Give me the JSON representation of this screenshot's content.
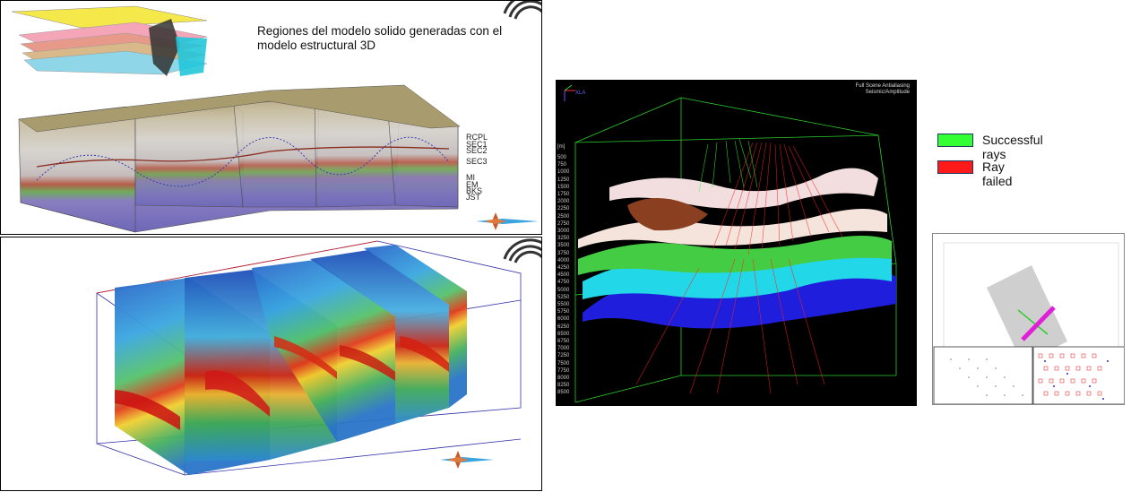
{
  "panel_structural": {
    "title": "Regiones del modelo solido generadas con el modelo estructural 3D",
    "horizons": [
      "RCPL",
      "SEC1",
      "SEC2",
      "SEC3",
      "MI",
      "EM",
      "BKS",
      "JST"
    ]
  },
  "viewer": {
    "header_line1": "Full Scene Antialiasing",
    "header_line2": "Seismic/Amplitude",
    "axis_label": "XLA",
    "depth_unit": "[m]",
    "depth_ticks": [
      "500",
      "750",
      "1000",
      "1250",
      "1500",
      "1750",
      "2000",
      "2250",
      "2500",
      "2750",
      "3000",
      "3250",
      "3500",
      "3750",
      "4000",
      "4250",
      "4500",
      "4750",
      "5000",
      "5250",
      "5500",
      "5750",
      "6000",
      "6250",
      "6500",
      "6750",
      "7000",
      "7250",
      "7500",
      "7750",
      "8000",
      "8250",
      "8500"
    ]
  },
  "legend": {
    "items": [
      {
        "label": "Successful rays",
        "color": "#33ff33"
      },
      {
        "label": "Ray failed",
        "color": "#ff1a1a"
      }
    ]
  },
  "colors": {
    "seismic_high": "#cc0000",
    "seismic_mid": "#22aa22",
    "seismic_low": "#1144bb"
  }
}
